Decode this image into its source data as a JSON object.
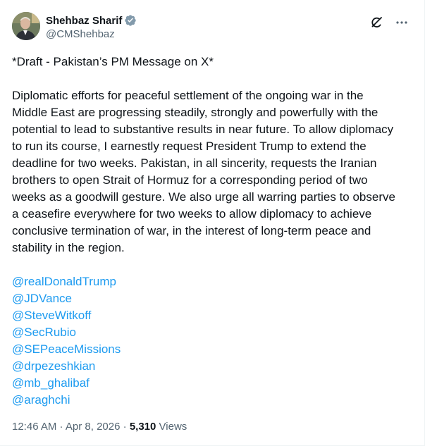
{
  "author": {
    "display_name": "Shehbaz Sharif",
    "handle": "@CMShehbaz",
    "verified": true
  },
  "icons": {
    "avatar": "profile-photo",
    "verified": "verified-badge-icon",
    "grok": "grok-icon",
    "more": "more-icon"
  },
  "colors": {
    "text": "#0f1419",
    "secondary": "#536471",
    "link": "#1d9bf0",
    "verified_badge": "#829aab"
  },
  "tweet": {
    "heading": "*Draft - Pakistan’s PM Message on X*",
    "body_lines": [
      "Diplomatic efforts for peaceful settlement of the ongoing war in the",
      "Middle East are progressing steadily, strongly and powerfully with the",
      "potential to lead to substantive results in near future. To allow diplomacy",
      "to run its course, I earnestly request President Trump to extend the",
      "deadline for two weeks. Pakistan, in all sincerity, requests the Iranian",
      "brothers to open Strait of Hormuz for a corresponding period of two",
      "weeks as a goodwill gesture. We also urge all warring parties to observe",
      "a ceasefire everywhere for two weeks to allow diplomacy to achieve",
      "conclusive termination of war, in the interest of long-term peace and",
      "stability in the region."
    ],
    "mentions": [
      "@realDonaldTrump",
      "@JDVance",
      "@SteveWitkoff",
      "@SecRubio",
      "@SEPeaceMissions",
      "@drpezeshkian",
      "@mb_ghalibaf",
      "@araghchi"
    ]
  },
  "meta": {
    "time": "12:46 AM",
    "separator": " · ",
    "date": "Apr 8, 2026",
    "views_count": "5,310",
    "views_label": "Views"
  }
}
